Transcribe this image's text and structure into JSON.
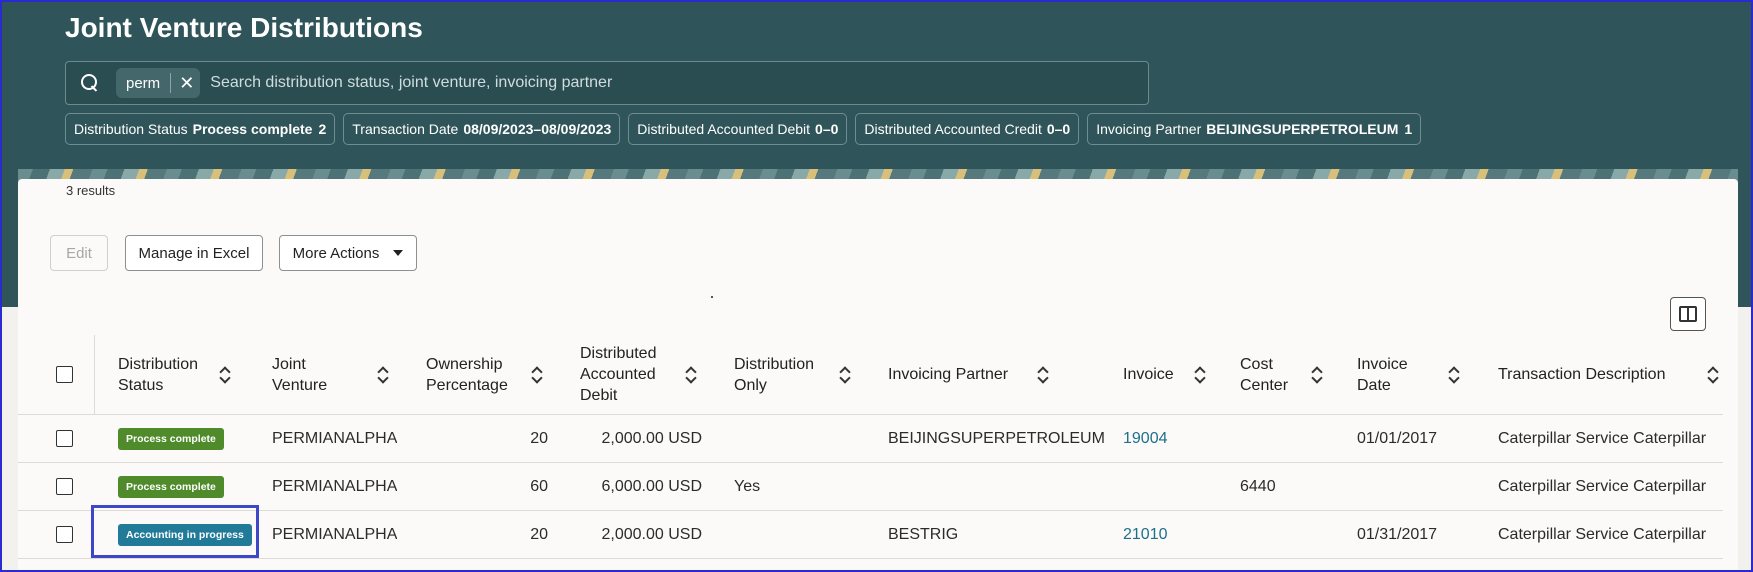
{
  "page": {
    "title": "Joint Venture Distributions"
  },
  "search": {
    "chip": "perm",
    "placeholder": "Search distribution status, joint venture, invoicing partner"
  },
  "filters": [
    {
      "label": "Distribution Status",
      "value": "Process complete",
      "count": "2"
    },
    {
      "label": "Transaction Date",
      "value": "08/09/2023–08/09/2023",
      "count": ""
    },
    {
      "label": "Distributed Accounted Debit",
      "value": "0–0",
      "count": ""
    },
    {
      "label": "Distributed Accounted Credit",
      "value": "0–0",
      "count": ""
    },
    {
      "label": "Invoicing Partner",
      "value": "BEIJINGSUPERPETROLEUM",
      "count": "1"
    }
  ],
  "results": {
    "count_text": "3 results"
  },
  "toolbar": {
    "edit": "Edit",
    "manage_excel": "Manage in Excel",
    "more_actions": "More Actions"
  },
  "table": {
    "headers": {
      "status": "Distribution\nStatus",
      "jv": "Joint\nVenture",
      "ownership": "Ownership\nPercentage",
      "debit": "Distributed\nAccounted\nDebit",
      "dist_only": "Distribution\nOnly",
      "partner": "Invoicing Partner",
      "invoice": "Invoice",
      "cost_center": "Cost\nCenter",
      "inv_date": "Invoice\nDate",
      "trans_desc": "Transaction Description"
    },
    "rows": [
      {
        "status": "Process complete",
        "status_color": "#4f8a2b",
        "jv": "PERMIANALPHA",
        "ownership": "20",
        "debit": "2,000.00 USD",
        "dist_only": "",
        "partner": "BEIJINGSUPERPETROLEUM",
        "invoice": "19004",
        "cost_center": "",
        "inv_date": "01/01/2017",
        "trans_desc": "Caterpillar Service Caterpillar"
      },
      {
        "status": "Process complete",
        "status_color": "#4f8a2b",
        "jv": "PERMIANALPHA",
        "ownership": "60",
        "debit": "6,000.00 USD",
        "dist_only": "Yes",
        "partner": "",
        "invoice": "",
        "cost_center": "6440",
        "inv_date": "",
        "trans_desc": "Caterpillar Service Caterpillar"
      },
      {
        "status": "Accounting in progress",
        "status_color": "#207a98",
        "jv": "PERMIANALPHA",
        "ownership": "20",
        "debit": "2,000.00 USD",
        "dist_only": "",
        "partner": "BESTRIG",
        "invoice": "21010",
        "cost_center": "",
        "inv_date": "01/31/2017",
        "trans_desc": "Caterpillar Service Caterpillar"
      }
    ]
  }
}
